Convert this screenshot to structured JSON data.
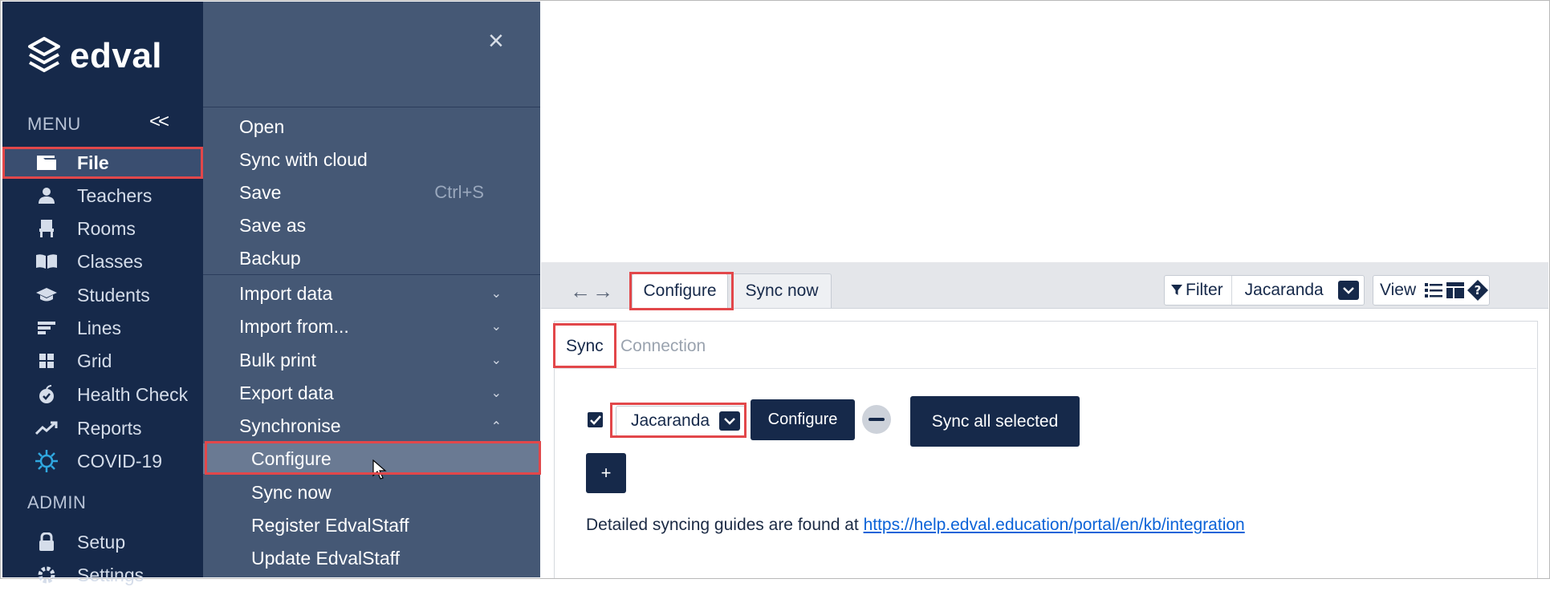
{
  "brand": {
    "name": "edval"
  },
  "sidebar": {
    "menu_label": "MENU",
    "collapse_glyph": "<<",
    "admin_label": "ADMIN",
    "items": [
      {
        "label": "File",
        "icon": "folder-icon"
      },
      {
        "label": "Teachers",
        "icon": "person-icon"
      },
      {
        "label": "Rooms",
        "icon": "chair-icon"
      },
      {
        "label": "Classes",
        "icon": "book-icon"
      },
      {
        "label": "Students",
        "icon": "graduation-cap-icon"
      },
      {
        "label": "Lines",
        "icon": "lines-icon"
      },
      {
        "label": "Grid",
        "icon": "grid-icon"
      },
      {
        "label": "Health Check",
        "icon": "apple-icon"
      },
      {
        "label": "Reports",
        "icon": "trend-icon"
      },
      {
        "label": "COVID-19",
        "icon": "virus-icon"
      }
    ],
    "admin_items": [
      {
        "label": "Setup",
        "icon": "lock-icon"
      },
      {
        "label": "Settings",
        "icon": "gear-icon"
      }
    ]
  },
  "file_menu": {
    "close_glyph": "×",
    "items": [
      {
        "label": "Open"
      },
      {
        "label": "Sync with cloud"
      },
      {
        "label": "Save",
        "shortcut": "Ctrl+S"
      },
      {
        "label": "Save as"
      },
      {
        "label": "Backup"
      },
      {
        "label": "Import data"
      },
      {
        "label": "Import from..."
      },
      {
        "label": "Bulk print"
      },
      {
        "label": "Export data"
      },
      {
        "label": "Synchronise"
      },
      {
        "label": "Configure"
      },
      {
        "label": "Sync now"
      },
      {
        "label": "Register EdvalStaff"
      },
      {
        "label": "Update EdvalStaff"
      }
    ]
  },
  "toolbar": {
    "tabs": [
      "Configure",
      "Sync now"
    ],
    "filter_label": "Filter",
    "filter_value": "Jacaranda",
    "view_label": "View"
  },
  "sync_panel": {
    "subtabs": [
      "Sync",
      "Connection"
    ],
    "provider_value": "Jacaranda",
    "configure_label": "Configure",
    "sync_all_label": "Sync all selected",
    "add_label": "+",
    "guide_text": "Detailed syncing guides are found at ",
    "guide_link": "https://help.edval.education/portal/en/kb/integration"
  },
  "colors": {
    "sidebar_bg": "#16294a",
    "panel_bg": "#455875",
    "accent_dark": "#16294a",
    "highlight_red": "#e2474a",
    "link_blue": "#0b63d8"
  }
}
